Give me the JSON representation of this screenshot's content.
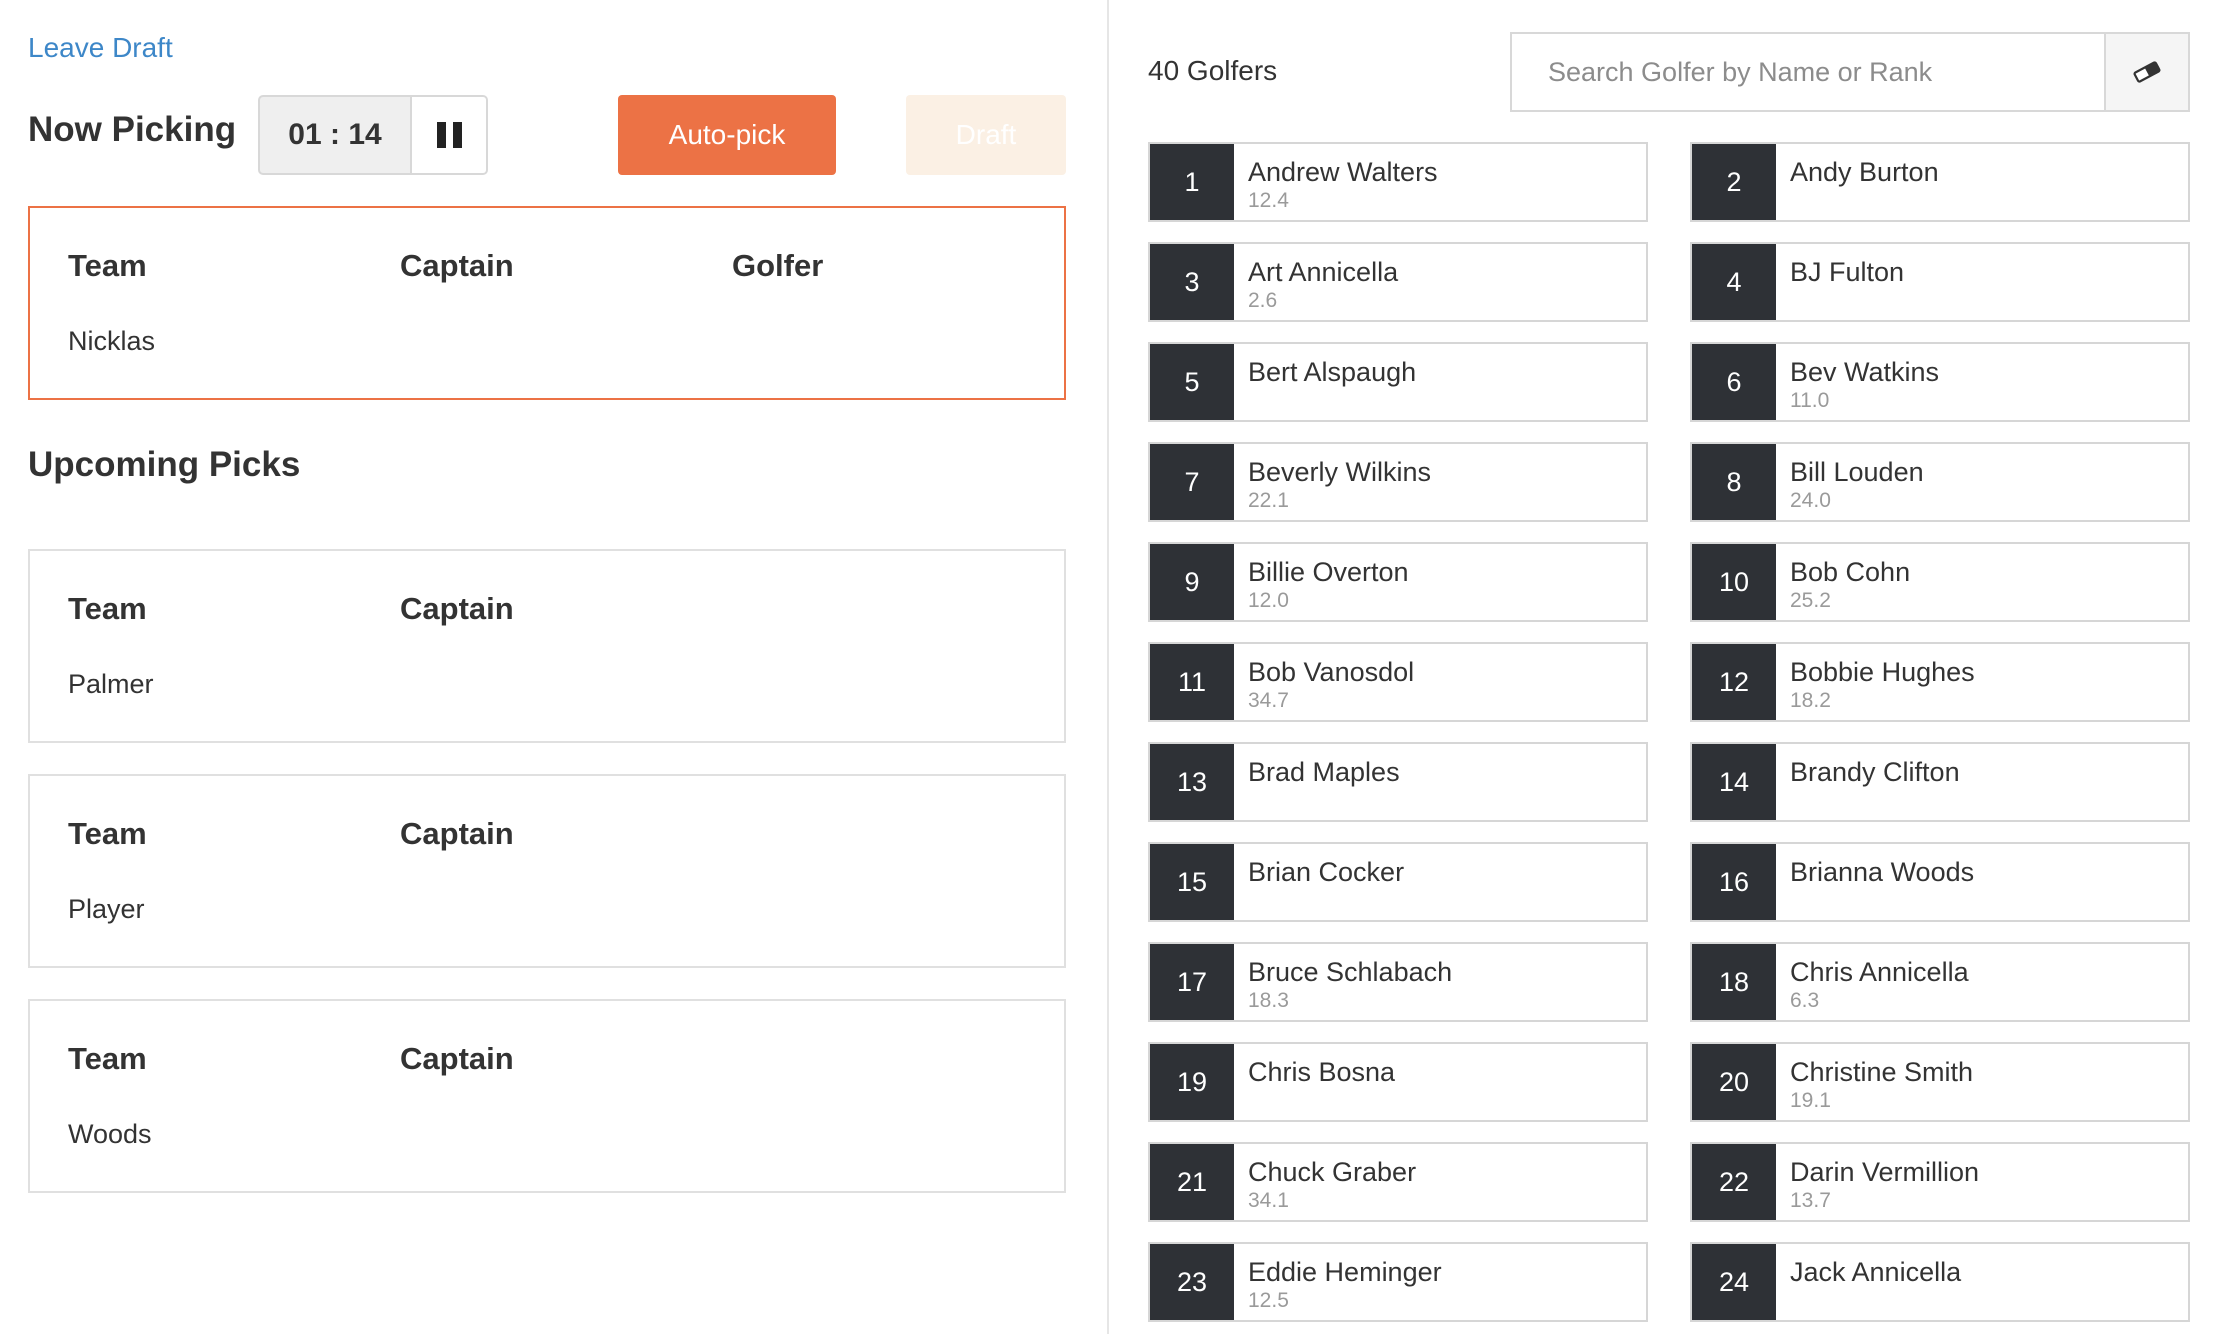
{
  "header": {
    "leave_draft": "Leave Draft",
    "now_picking": "Now Picking",
    "timer": "01 : 14",
    "autopick_label": "Auto-pick",
    "draft_label": "Draft"
  },
  "current_pick": {
    "team_label": "Team",
    "captain_label": "Captain",
    "golfer_label": "Golfer",
    "team": "Nicklas"
  },
  "upcoming": {
    "title": "Upcoming Picks",
    "picks": [
      {
        "team_label": "Team",
        "captain_label": "Captain",
        "team": "Palmer"
      },
      {
        "team_label": "Team",
        "captain_label": "Captain",
        "team": "Player"
      },
      {
        "team_label": "Team",
        "captain_label": "Captain",
        "team": "Woods"
      }
    ]
  },
  "golfers_panel": {
    "count_label": "40 Golfers",
    "search_placeholder": "Search Golfer by Name or Rank",
    "golfers": [
      {
        "rank": "1",
        "name": "Andrew Walters",
        "hcp": "12.4"
      },
      {
        "rank": "2",
        "name": "Andy Burton",
        "hcp": ""
      },
      {
        "rank": "3",
        "name": "Art Annicella",
        "hcp": "2.6"
      },
      {
        "rank": "4",
        "name": "BJ Fulton",
        "hcp": ""
      },
      {
        "rank": "5",
        "name": "Bert Alspaugh",
        "hcp": ""
      },
      {
        "rank": "6",
        "name": "Bev Watkins",
        "hcp": "11.0"
      },
      {
        "rank": "7",
        "name": "Beverly Wilkins",
        "hcp": "22.1"
      },
      {
        "rank": "8",
        "name": "Bill Louden",
        "hcp": "24.0"
      },
      {
        "rank": "9",
        "name": "Billie Overton",
        "hcp": "12.0"
      },
      {
        "rank": "10",
        "name": "Bob Cohn",
        "hcp": "25.2"
      },
      {
        "rank": "11",
        "name": "Bob Vanosdol",
        "hcp": "34.7"
      },
      {
        "rank": "12",
        "name": "Bobbie Hughes",
        "hcp": "18.2"
      },
      {
        "rank": "13",
        "name": "Brad Maples",
        "hcp": ""
      },
      {
        "rank": "14",
        "name": "Brandy Clifton",
        "hcp": ""
      },
      {
        "rank": "15",
        "name": "Brian Cocker",
        "hcp": ""
      },
      {
        "rank": "16",
        "name": "Brianna Woods",
        "hcp": ""
      },
      {
        "rank": "17",
        "name": "Bruce Schlabach",
        "hcp": "18.3"
      },
      {
        "rank": "18",
        "name": "Chris Annicella",
        "hcp": "6.3"
      },
      {
        "rank": "19",
        "name": "Chris Bosna",
        "hcp": ""
      },
      {
        "rank": "20",
        "name": "Christine Smith",
        "hcp": "19.1"
      },
      {
        "rank": "21",
        "name": "Chuck Graber",
        "hcp": "34.1"
      },
      {
        "rank": "22",
        "name": "Darin Vermillion",
        "hcp": "13.7"
      },
      {
        "rank": "23",
        "name": "Eddie Heminger",
        "hcp": "12.5"
      },
      {
        "rank": "24",
        "name": "Jack Annicella",
        "hcp": ""
      }
    ]
  },
  "colors": {
    "accent": "#ec7245",
    "link": "#3d87c8",
    "rank_bg": "#2e3136"
  }
}
